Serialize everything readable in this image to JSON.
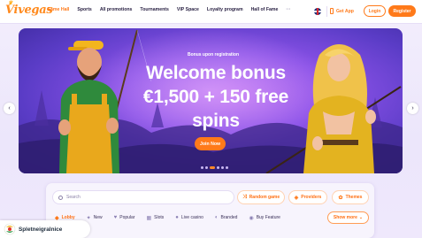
{
  "header": {
    "logo": "Vivegas",
    "nav": [
      {
        "label": "Game Hall",
        "active": true
      },
      {
        "label": "Sports",
        "active": false
      },
      {
        "label": "All promotions",
        "active": false
      },
      {
        "label": "Tournaments",
        "active": false
      },
      {
        "label": "VIP Space",
        "active": false
      },
      {
        "label": "Loyalty program",
        "active": false
      },
      {
        "label": "Hall of Fame",
        "active": false
      }
    ],
    "more": "···",
    "language_icon": "uk-flag-icon",
    "get_app": "Get App",
    "login": "Login",
    "register": "Register"
  },
  "banner": {
    "label": "Bonus upon registration",
    "headline_line1": "Welcome bonus",
    "headline_line2": "€1,500 + 150 free",
    "headline_line3": "spins",
    "cta": "Join Now",
    "slide_count": 6,
    "active_slide": 3,
    "prev_icon": "chevron-left-icon",
    "next_icon": "chevron-right-icon"
  },
  "filters": {
    "search_placeholder": "Search",
    "search_value": "",
    "chips": [
      {
        "label": "Random game",
        "icon": "shuffle-icon"
      },
      {
        "label": "Providers",
        "icon": "provider-icon"
      },
      {
        "label": "Themes",
        "icon": "palette-icon"
      }
    ],
    "categories": [
      {
        "label": "Lobby",
        "icon": "lobby-icon",
        "active": true
      },
      {
        "label": "New",
        "icon": "new-icon",
        "active": false
      },
      {
        "label": "Popular",
        "icon": "heart-icon",
        "active": false
      },
      {
        "label": "Slots",
        "icon": "slots-icon",
        "active": false
      },
      {
        "label": "Live casino",
        "icon": "live-icon",
        "active": false
      },
      {
        "label": "Branded",
        "icon": "branded-icon",
        "active": false
      },
      {
        "label": "Buy Feature",
        "icon": "buy-feature-icon",
        "active": false
      }
    ],
    "show_more": "Show more"
  },
  "watermark": {
    "text": "Spletneigralnice"
  },
  "colors": {
    "accent": "#ff7a1a",
    "banner_primary": "#8b52e8",
    "page_bg": "#f3eefc",
    "text_dark": "#2b2345"
  }
}
